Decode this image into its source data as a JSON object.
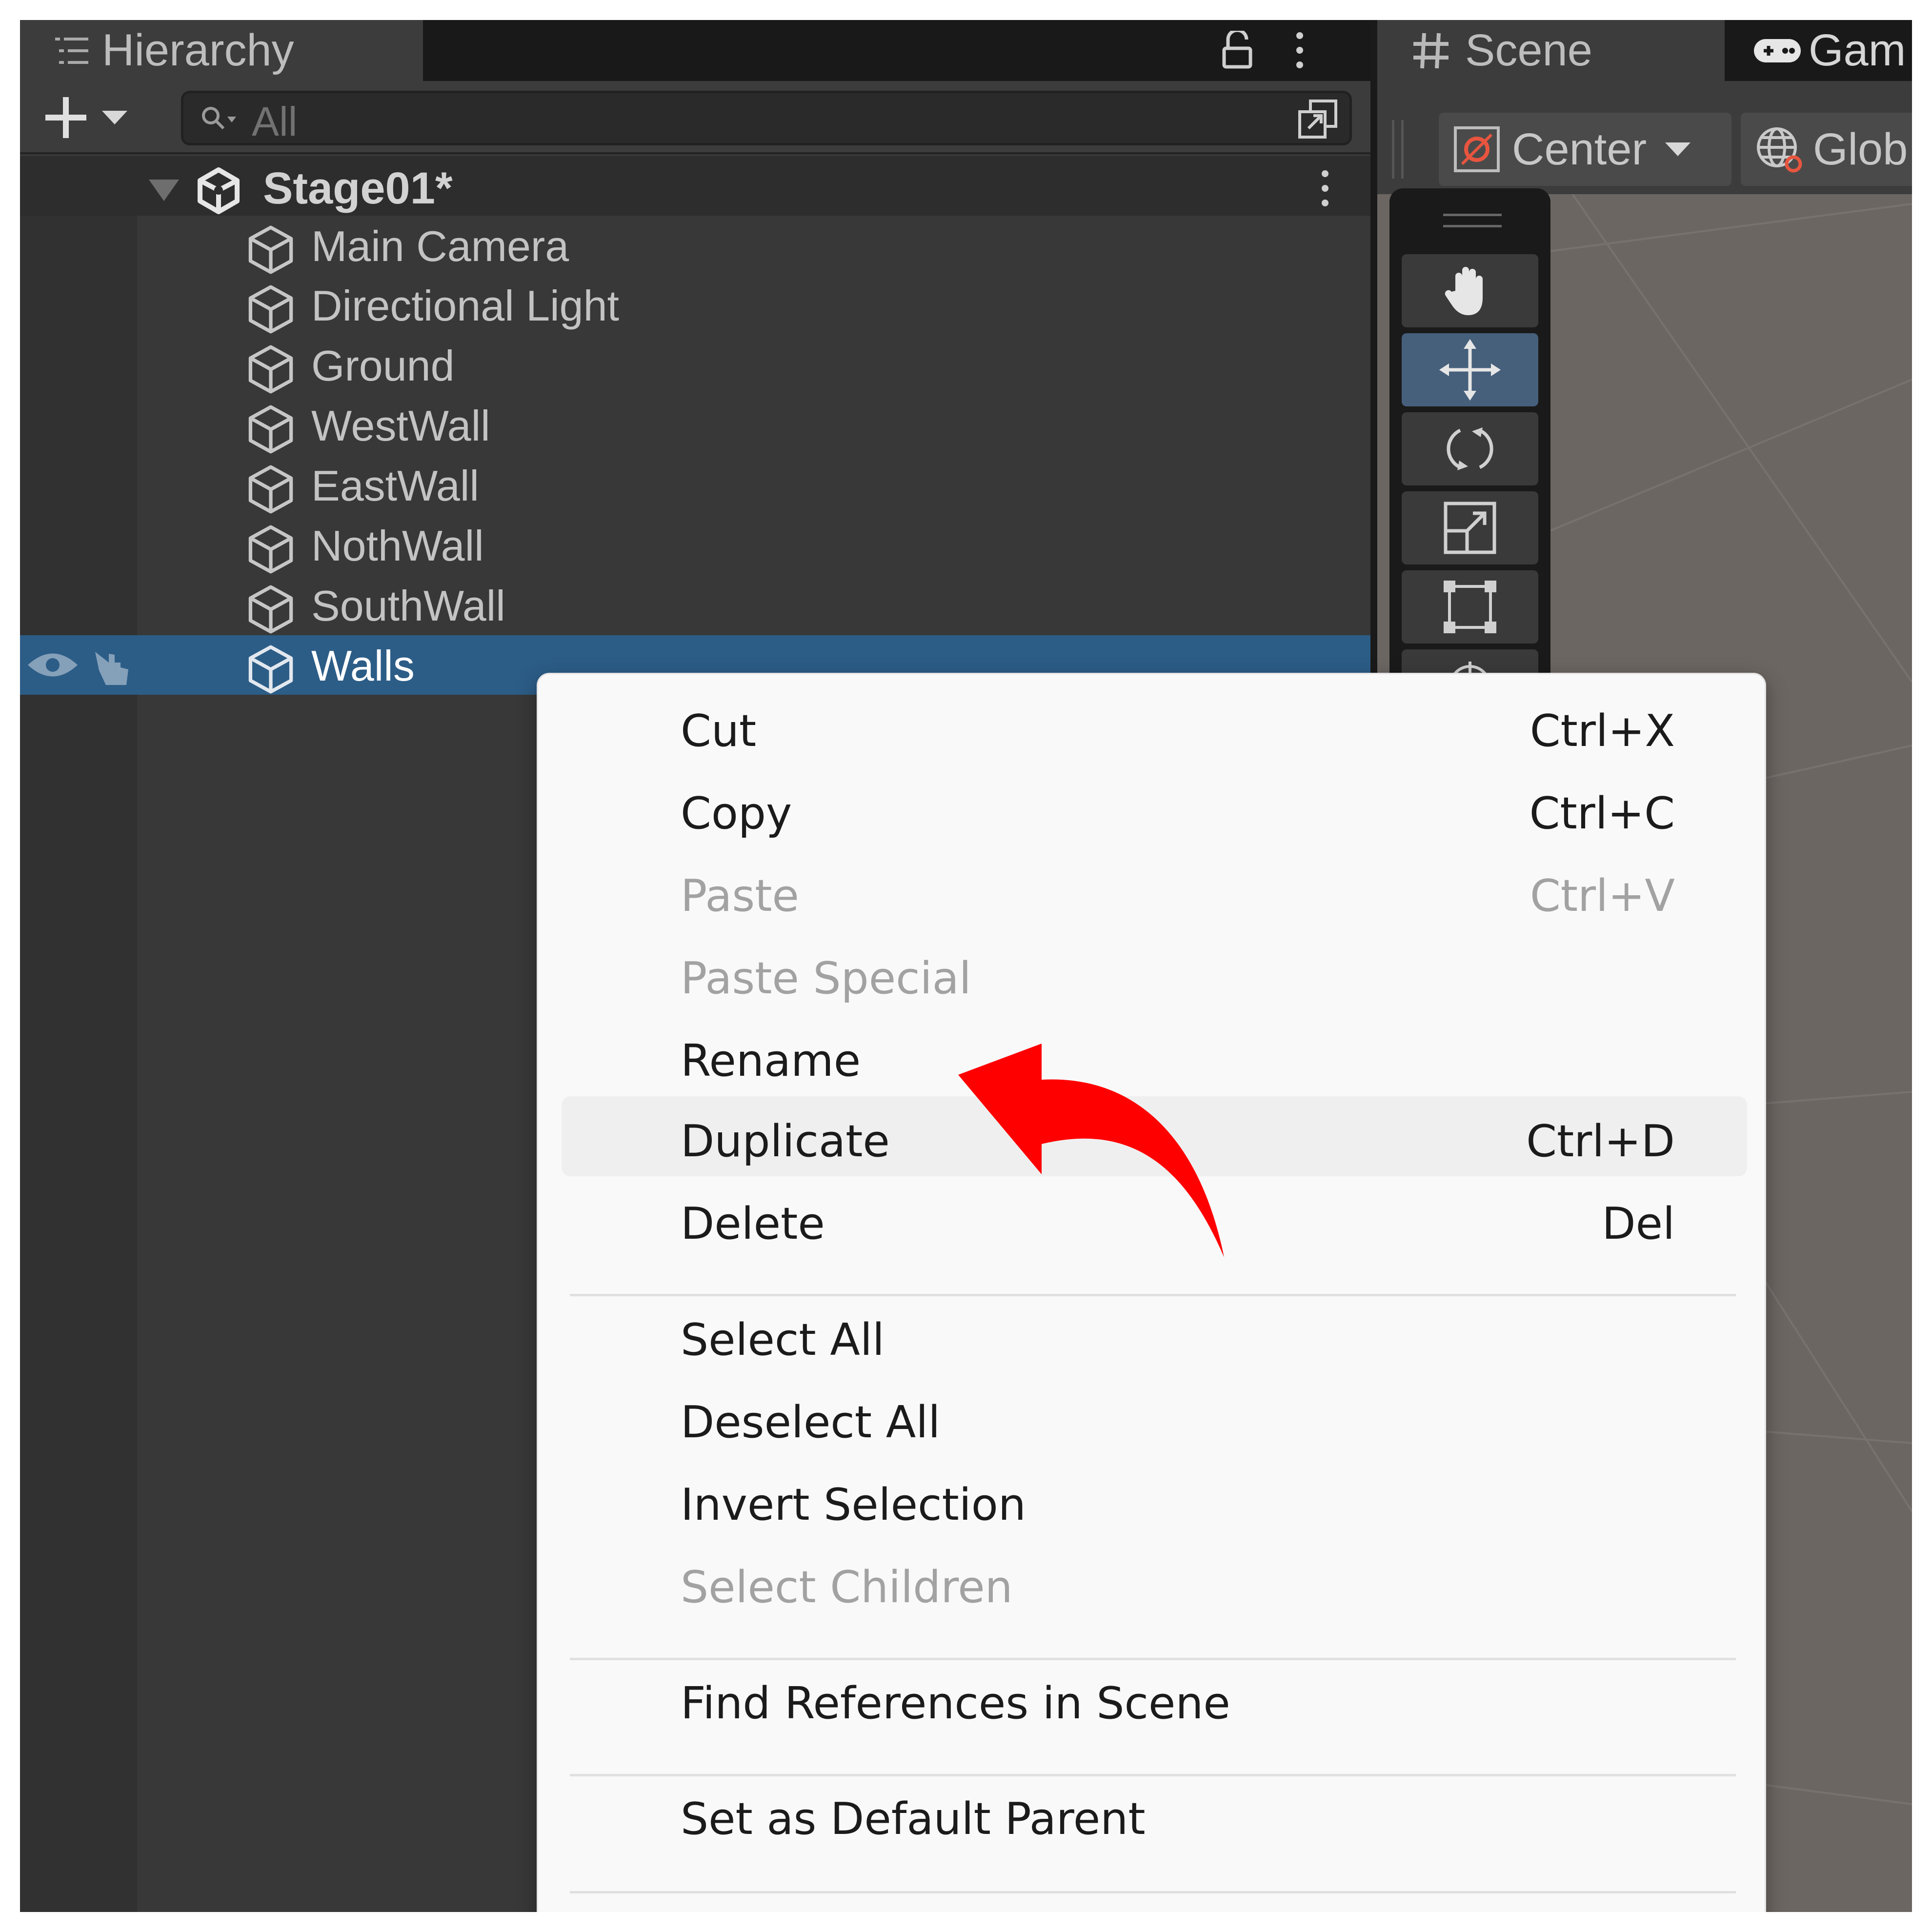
{
  "hierarchy": {
    "tab_title": "Hierarchy",
    "search_placeholder": "All",
    "scene_name": "Stage01*",
    "objects": [
      "Main Camera",
      "Directional Light",
      "Ground",
      "WestWall",
      "EastWall",
      "NothWall",
      "SouthWall",
      "Walls"
    ],
    "selected_object": "Walls"
  },
  "scene": {
    "tab_scene": "Scene",
    "tab_game": "Gam",
    "pivot_label": "Center",
    "space_label": "Glob"
  },
  "context_menu": {
    "items": [
      {
        "label": "Cut",
        "shortcut": "Ctrl+X"
      },
      {
        "label": "Copy",
        "shortcut": "Ctrl+C"
      },
      {
        "label": "Paste",
        "shortcut": "Ctrl+V"
      },
      {
        "label": "Paste Special",
        "shortcut": ""
      },
      {
        "label": "Rename",
        "shortcut": ""
      },
      {
        "label": "Duplicate",
        "shortcut": "Ctrl+D"
      },
      {
        "label": "Delete",
        "shortcut": "Del"
      },
      {
        "label": "Select All",
        "shortcut": ""
      },
      {
        "label": "Deselect All",
        "shortcut": ""
      },
      {
        "label": "Invert Selection",
        "shortcut": ""
      },
      {
        "label": "Select Children",
        "shortcut": ""
      },
      {
        "label": "Find References in Scene",
        "shortcut": ""
      },
      {
        "label": "Set as Default Parent",
        "shortcut": ""
      }
    ],
    "disabled": [
      "Paste",
      "Paste Special",
      "Select Children"
    ],
    "highlighted": "Duplicate"
  },
  "colors": {
    "selection": "#2c5d87",
    "annotation_arrow": "#ff0000"
  },
  "icons": {
    "hierarchy_tab": "list-icon",
    "lock": "lock-icon",
    "menu": "kebab-icon",
    "add": "plus-icon",
    "search": "search-icon",
    "expand": "expand-icon",
    "scene_root": "unity-logo-icon",
    "game_object": "cube-icon",
    "visibility": "eye-icon",
    "pickability": "hand-pointer-icon",
    "scene_tab": "grid-hash-icon",
    "game_tab": "gamepad-icon",
    "pivot": "pivot-icon",
    "space": "globe-icon",
    "tools": [
      "hand-icon",
      "move-icon",
      "rotate-icon",
      "scale-icon",
      "rect-icon"
    ]
  }
}
